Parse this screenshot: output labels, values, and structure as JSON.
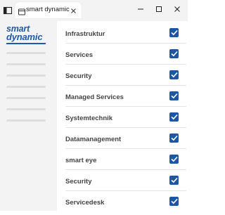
{
  "tab": {
    "title": "smart dynamic"
  },
  "logo": {
    "line1": "smart",
    "line2": "dynamic",
    "color": "#1e5aa8"
  },
  "colors": {
    "checkbox": "#1e56a0",
    "sidebar_bg": "#f3f3f3",
    "label_text": "#444444"
  },
  "icons": {
    "sidebar_toggle": "sidebar-toggle-icon",
    "tab": "tab-page-icon",
    "tab_close": "close-icon",
    "minimize": "minimize-icon",
    "maximize": "maximize-icon",
    "close": "close-icon",
    "check": "checkmark-icon"
  },
  "items": [
    {
      "label": "Infrastruktur",
      "checked": true
    },
    {
      "label": "Services",
      "checked": true
    },
    {
      "label": "Security",
      "checked": true
    },
    {
      "label": "Managed Services",
      "checked": true
    },
    {
      "label": "Systemtechnik",
      "checked": true
    },
    {
      "label": "Datamanagement",
      "checked": true
    },
    {
      "label": "smart eye",
      "checked": true
    },
    {
      "label": "Security",
      "checked": true
    },
    {
      "label": "Servicedesk",
      "checked": true
    }
  ]
}
